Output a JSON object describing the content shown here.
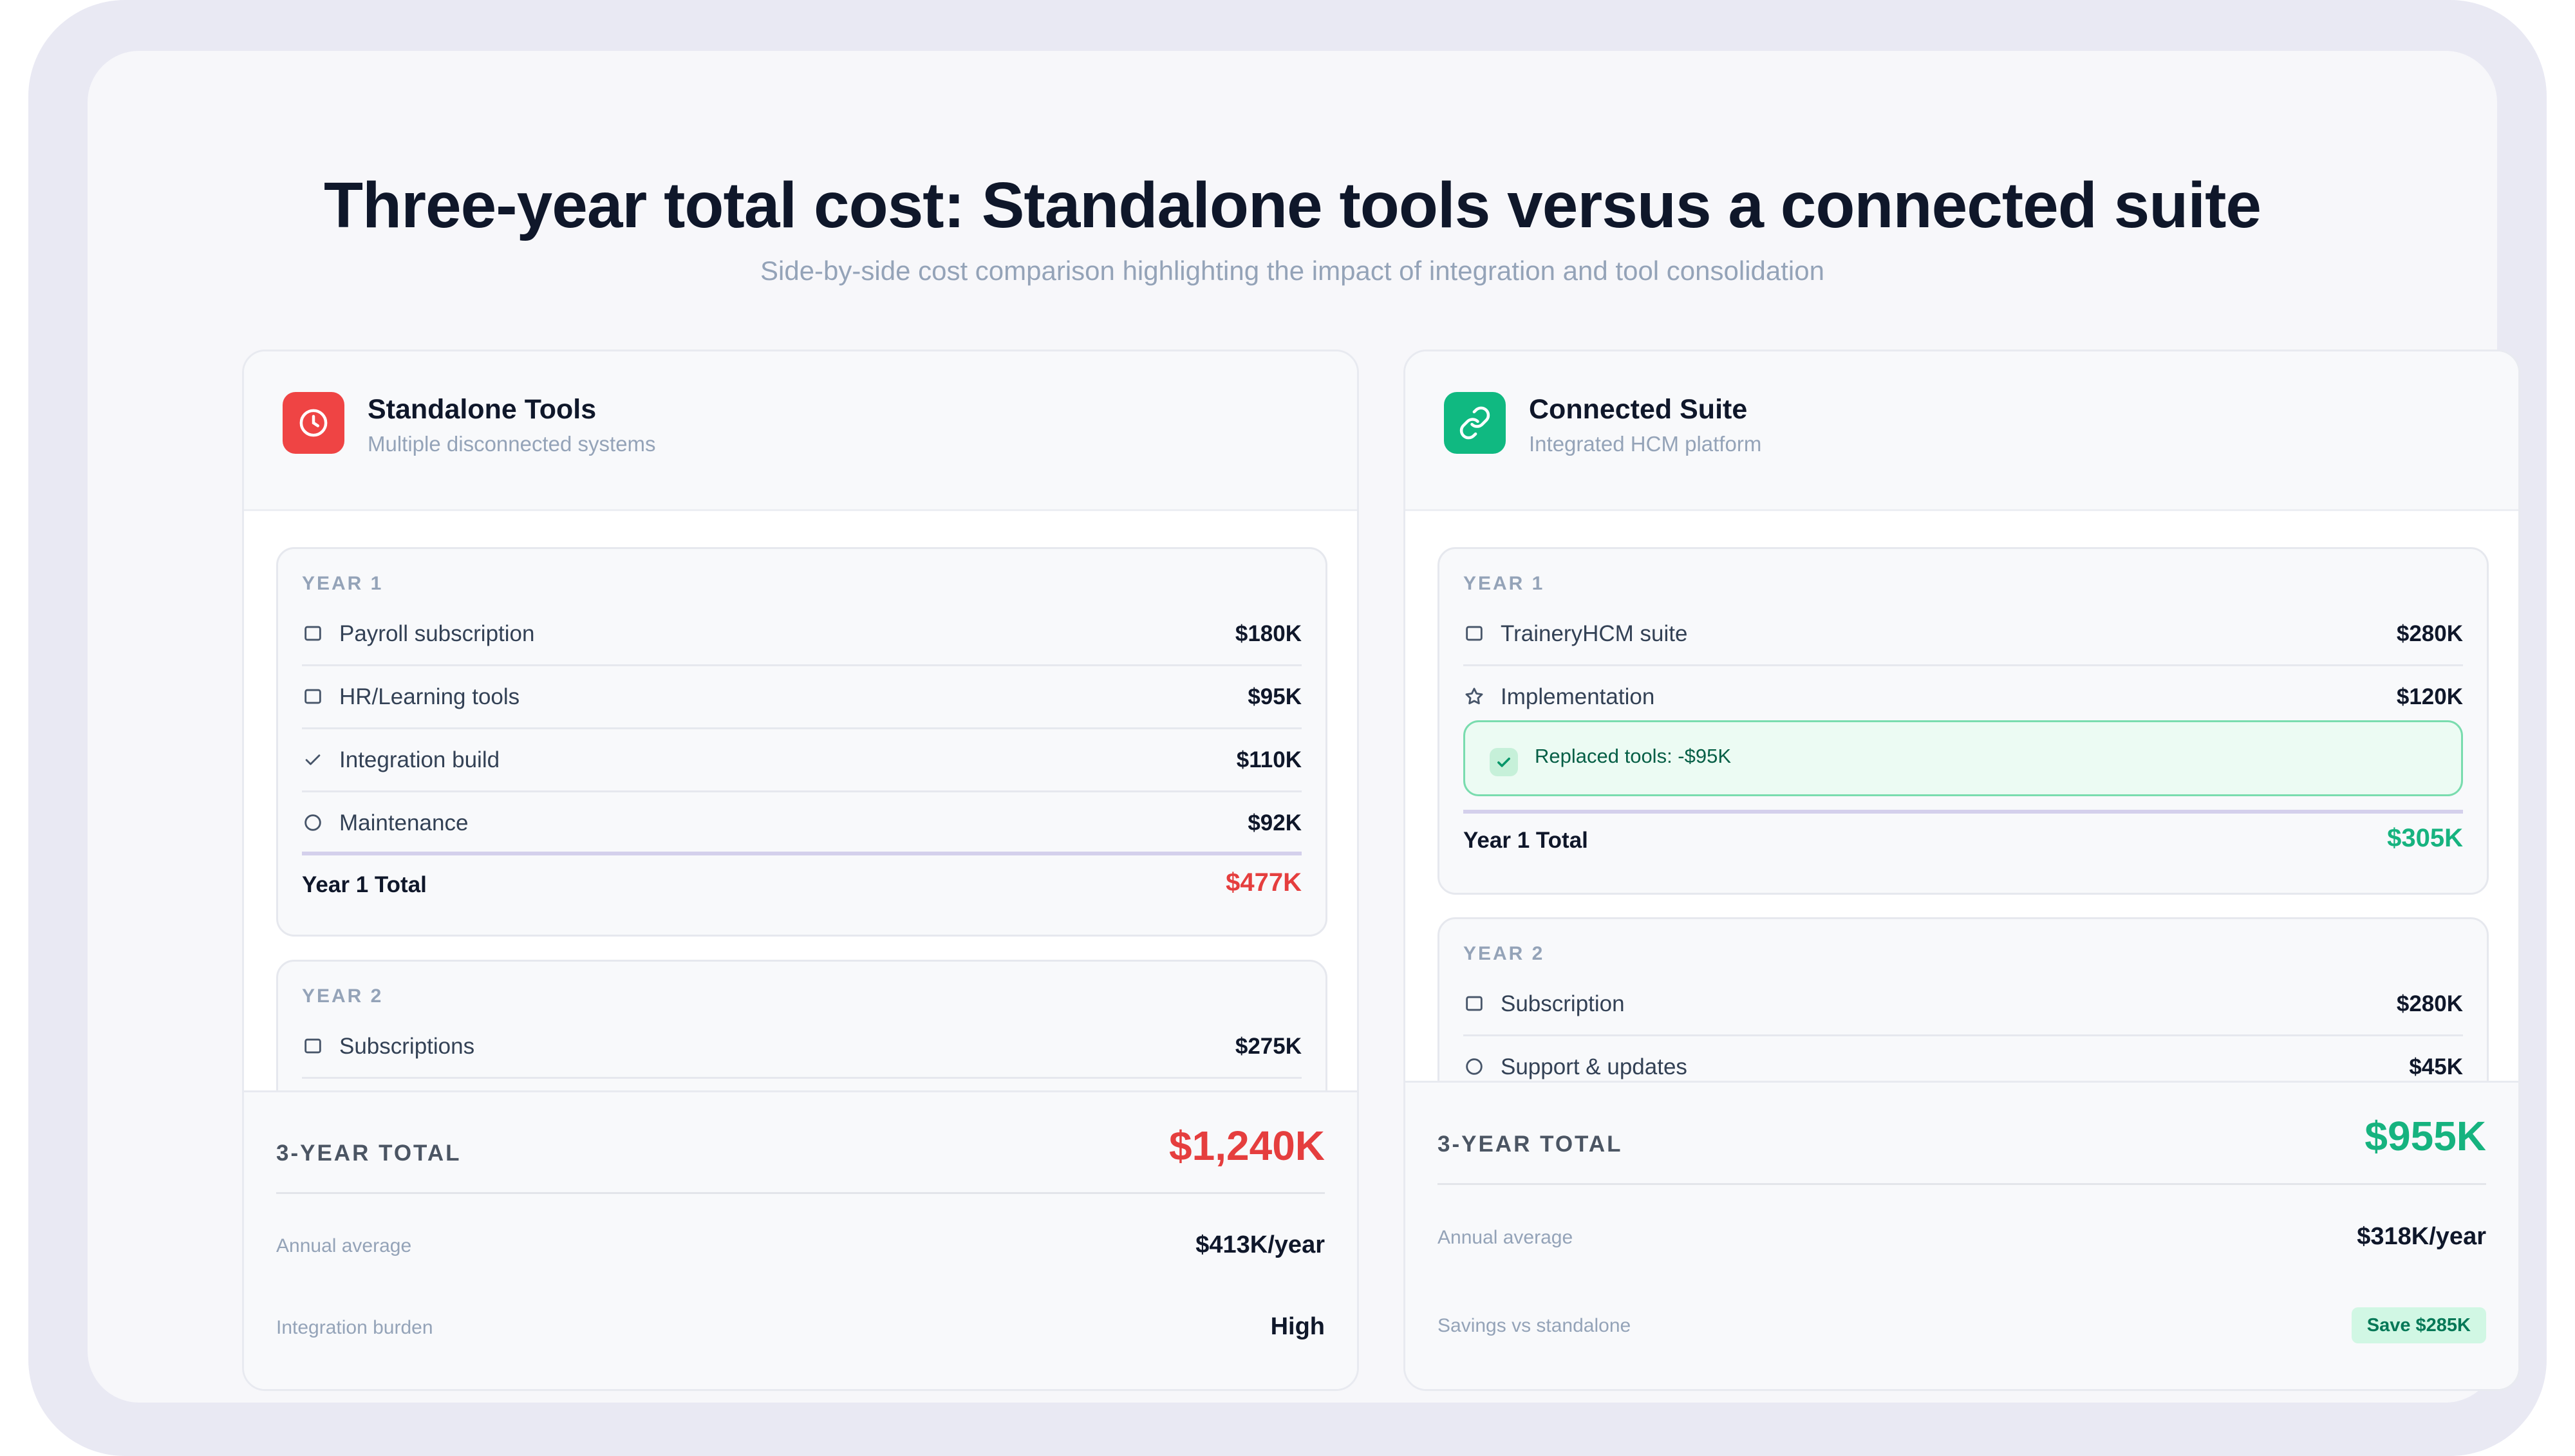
{
  "page": {
    "title": "Three-year total cost: Standalone tools versus a connected suite",
    "subtitle": "Side-by-side cost comparison highlighting the impact of integration and tool consolidation"
  },
  "colors": {
    "negative": "#e53e3e",
    "positive": "#16b37f",
    "accent_divider": "#d4d0ec"
  },
  "standalone": {
    "icon": "clock-icon",
    "title": "Standalone Tools",
    "subtitle": "Multiple disconnected systems",
    "year1": {
      "label": "YEAR 1",
      "items": [
        {
          "icon": "square-icon",
          "label": "Payroll subscription",
          "value": "$180K"
        },
        {
          "icon": "square-icon",
          "label": "HR/Learning tools",
          "value": "$95K"
        },
        {
          "icon": "check-icon",
          "label": "Integration build",
          "value": "$110K"
        },
        {
          "icon": "circle-icon",
          "label": "Maintenance",
          "value": "$92K"
        }
      ],
      "total_label": "Year 1 Total",
      "total_value": "$477K"
    },
    "year2": {
      "label": "YEAR 2",
      "items": [
        {
          "icon": "square-icon",
          "label": "Subscriptions",
          "value": "$275K"
        }
      ]
    },
    "footer": {
      "total_label": "3-YEAR TOTAL",
      "total_value": "$1,240K",
      "avg_label": "Annual average",
      "avg_value": "$413K/year",
      "burden_label": "Integration burden",
      "burden_value": "High"
    }
  },
  "suite": {
    "icon": "link-icon",
    "title": "Connected Suite",
    "subtitle": "Integrated HCM platform",
    "year1": {
      "label": "YEAR 1",
      "items": [
        {
          "icon": "square-icon",
          "label": "TraineryHCM suite",
          "value": "$280K"
        },
        {
          "icon": "star-icon",
          "label": "Implementation",
          "value": "$120K"
        }
      ],
      "callout": "Replaced tools: -$95K",
      "total_label": "Year 1 Total",
      "total_value": "$305K"
    },
    "year2": {
      "label": "YEAR 2",
      "items": [
        {
          "icon": "square-icon",
          "label": "Subscription",
          "value": "$280K"
        },
        {
          "icon": "circle-icon",
          "label": "Support & updates",
          "value": "$45K"
        }
      ]
    },
    "footer": {
      "total_label": "3-YEAR TOTAL",
      "total_value": "$955K",
      "avg_label": "Annual average",
      "avg_value": "$318K/year",
      "savings_label": "Savings vs standalone",
      "savings_value": "Save $285K"
    }
  }
}
